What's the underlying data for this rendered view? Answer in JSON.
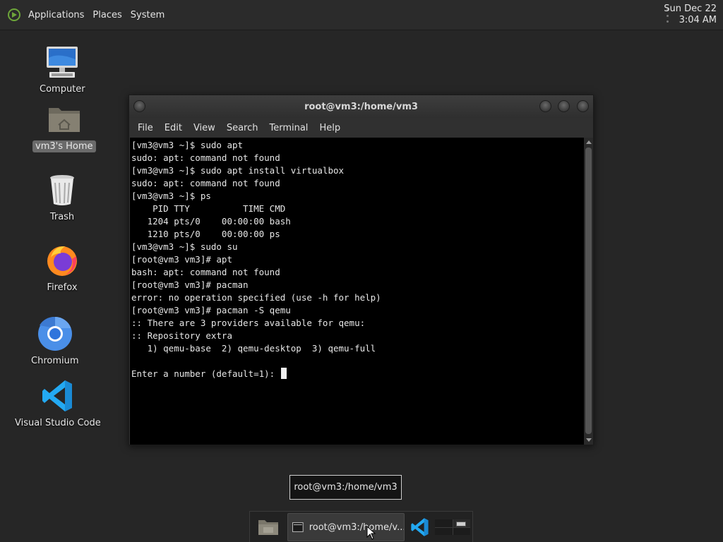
{
  "top_panel": {
    "menus": [
      "Applications",
      "Places",
      "System"
    ],
    "clock_date": "Sun Dec 22",
    "clock_time": "3:04 AM"
  },
  "desktop": {
    "icons": [
      {
        "label": "Computer",
        "icon": "computer-icon"
      },
      {
        "label": "vm3's Home",
        "icon": "home-folder-icon",
        "selected": true
      },
      {
        "label": "Trash",
        "icon": "trash-icon"
      },
      {
        "label": "Firefox",
        "icon": "firefox-icon"
      },
      {
        "label": "Chromium",
        "icon": "chromium-icon"
      },
      {
        "label": "Visual Studio Code",
        "icon": "vscode-icon"
      }
    ]
  },
  "window": {
    "title": "root@vm3:/home/vm3",
    "menu": [
      "File",
      "Edit",
      "View",
      "Search",
      "Terminal",
      "Help"
    ]
  },
  "terminal": {
    "lines": [
      "[vm3@vm3 ~]$ sudo apt",
      "sudo: apt: command not found",
      "[vm3@vm3 ~]$ sudo apt install virtualbox",
      "sudo: apt: command not found",
      "[vm3@vm3 ~]$ ps",
      "    PID TTY          TIME CMD",
      "   1204 pts/0    00:00:00 bash",
      "   1210 pts/0    00:00:00 ps",
      "[vm3@vm3 ~]$ sudo su",
      "[root@vm3 vm3]# apt",
      "bash: apt: command not found",
      "[root@vm3 vm3]# pacman",
      "error: no operation specified (use -h for help)",
      "[root@vm3 vm3]# pacman -S qemu",
      ":: There are 3 providers available for qemu:",
      ":: Repository extra",
      "   1) qemu-base  2) qemu-desktop  3) qemu-full",
      "",
      "Enter a number (default=1): "
    ]
  },
  "tooltip": {
    "text": "root@vm3:/home/vm3"
  },
  "bottom_panel": {
    "task_label": "root@vm3:/home/v..."
  },
  "colors": {
    "desktop_bg": "#262626",
    "panel_bg": "#2b2b2b",
    "terminal_bg": "#000000",
    "vscode_blue": "#23a9f2",
    "chromium_blue": "#4a8fe8"
  }
}
